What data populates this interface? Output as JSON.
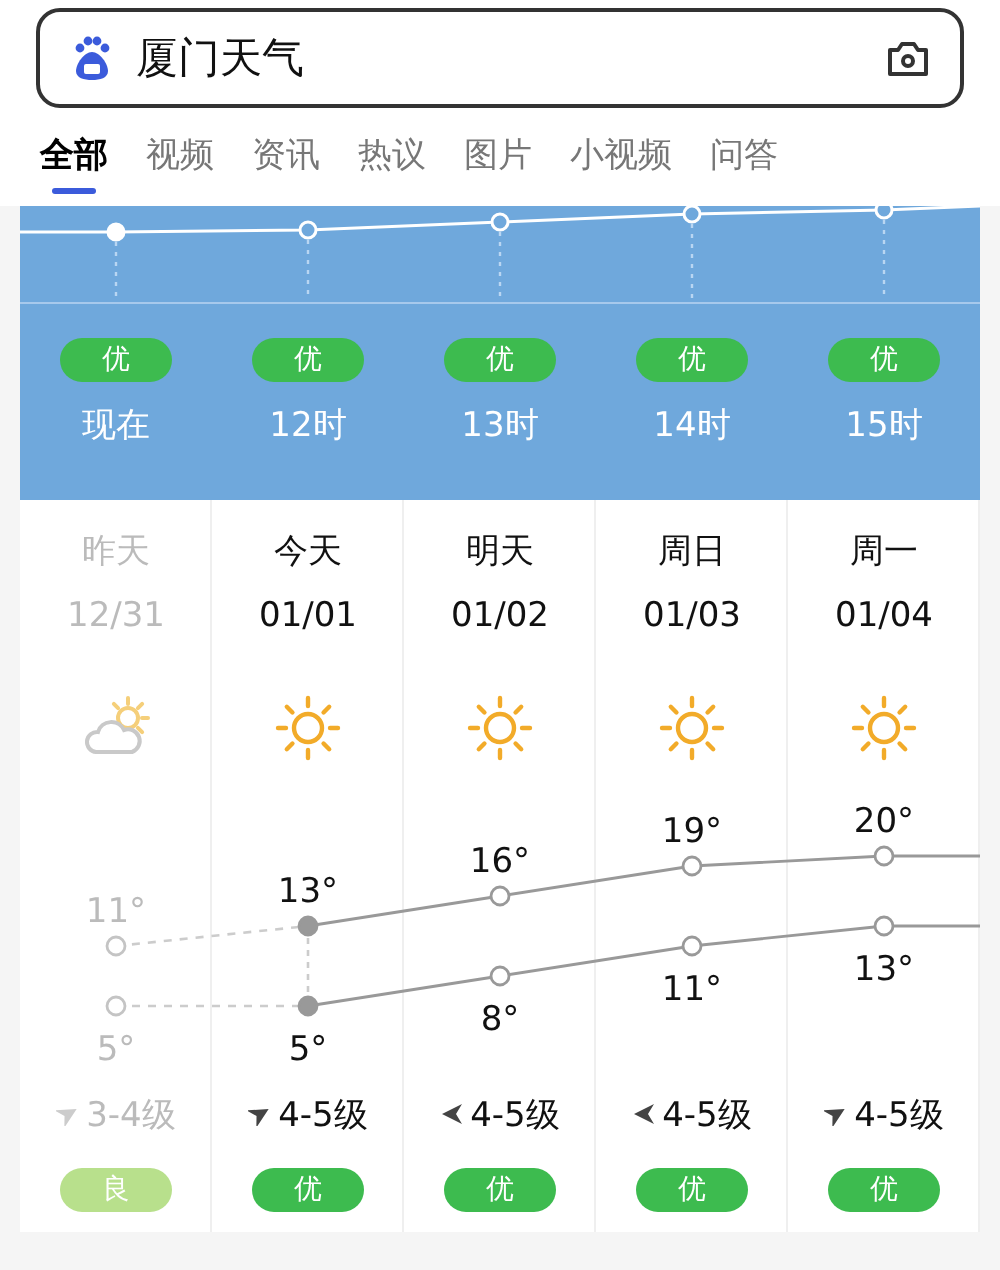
{
  "search": {
    "value": "厦门天气"
  },
  "tabs": [
    {
      "label": "全部",
      "selected": true
    },
    {
      "label": "视频",
      "selected": false
    },
    {
      "label": "资讯",
      "selected": false
    },
    {
      "label": "热议",
      "selected": false
    },
    {
      "label": "图片",
      "selected": false
    },
    {
      "label": "小视频",
      "selected": false
    },
    {
      "label": "问答",
      "selected": false
    }
  ],
  "hourly": [
    {
      "aqi": "优",
      "color": "#3dbb4f",
      "time": "现在",
      "current": true
    },
    {
      "aqi": "优",
      "color": "#3dbb4f",
      "time": "12时",
      "current": false
    },
    {
      "aqi": "优",
      "color": "#3dbb4f",
      "time": "13时",
      "current": false
    },
    {
      "aqi": "优",
      "color": "#3dbb4f",
      "time": "14时",
      "current": false
    },
    {
      "aqi": "优",
      "color": "#3dbb4f",
      "time": "15时",
      "current": false
    }
  ],
  "days": [
    {
      "kind": "past",
      "name": "昨天",
      "date": "12/31",
      "weather": {
        "kind": "partly_cloudy"
      },
      "high": "11°",
      "low": "5°",
      "wind": {
        "kind": "ne",
        "text": "3-4级"
      },
      "aqi": "良",
      "color": "#b8e08c"
    },
    {
      "kind": "today",
      "name": "今天",
      "date": "01/01",
      "weather": {
        "kind": "sunny"
      },
      "high": "13°",
      "low": "5°",
      "wind": {
        "kind": "ne",
        "text": "4-5级"
      },
      "aqi": "优",
      "color": "#3dbb4f"
    },
    {
      "kind": "future",
      "name": "明天",
      "date": "01/02",
      "weather": {
        "kind": "sunny"
      },
      "high": "16°",
      "low": "8°",
      "wind": {
        "kind": "w",
        "text": "4-5级"
      },
      "aqi": "优",
      "color": "#3dbb4f"
    },
    {
      "kind": "future",
      "name": "周日",
      "date": "01/03",
      "weather": {
        "kind": "sunny"
      },
      "high": "19°",
      "low": "11°",
      "wind": {
        "kind": "w",
        "text": "4-5级"
      },
      "aqi": "优",
      "color": "#3dbb4f"
    },
    {
      "kind": "future",
      "name": "周一",
      "date": "01/04",
      "weather": {
        "kind": "sunny"
      },
      "high": "20°",
      "low": "13°",
      "wind": {
        "kind": "ne",
        "text": "4-5级"
      },
      "aqi": "优",
      "color": "#3dbb4f"
    }
  ]
}
